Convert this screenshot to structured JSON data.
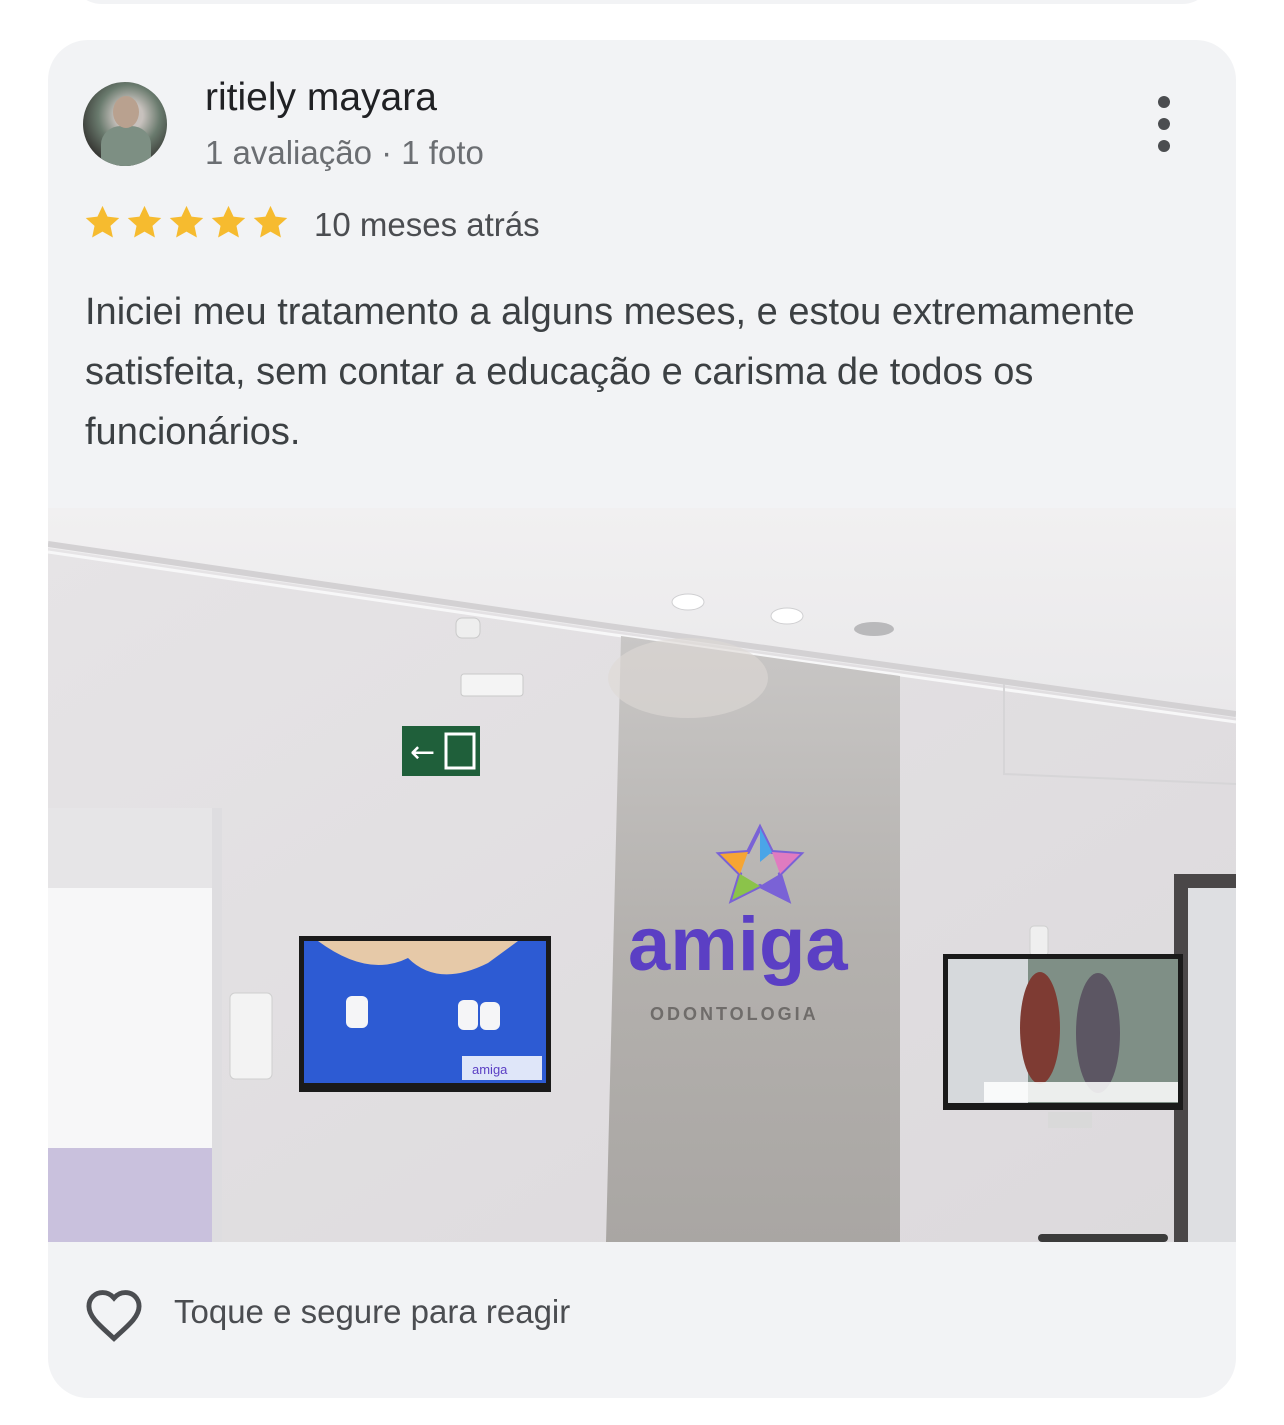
{
  "review": {
    "author": "ritiely mayara",
    "author_meta": "1 avaliação · 1 foto",
    "rating": 5,
    "rating_max": 5,
    "time_ago": "10 meses atrás",
    "text": "Iniciei meu tratamento a alguns meses, e estou extremamente satisfeita, sem contar a educação e carisma de todos os funcionários.",
    "more_icon": "more-vert-icon",
    "photo": {
      "logo_text": "amiga",
      "logo_subtitle": "ODONTOLOGIA",
      "tv_label": "amiga"
    }
  },
  "footer": {
    "react_icon": "heart-outline-icon",
    "react_text": "Toque e segure para reagir"
  },
  "colors": {
    "card_bg": "#f2f3f5",
    "star": "#f6bb2f",
    "text_primary": "#202124",
    "text_secondary": "#6b6e72",
    "logo_purple": "#5b3fc4"
  }
}
